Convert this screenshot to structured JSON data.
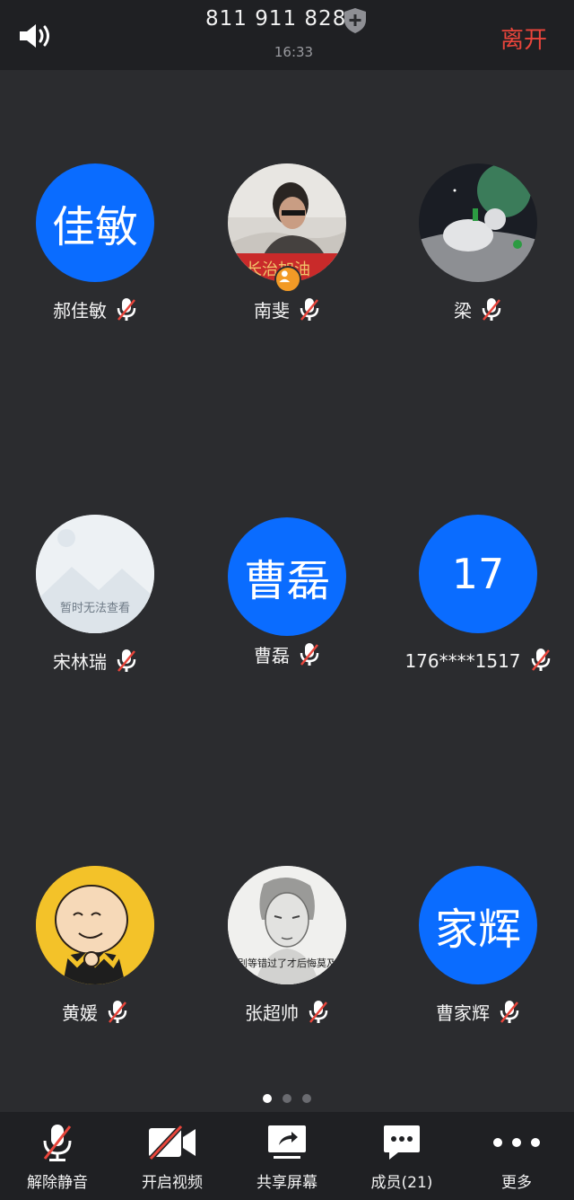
{
  "header": {
    "meeting_id": "811 911 828",
    "time": "16:33",
    "leave_label": "离开"
  },
  "participants": [
    {
      "name": "郝佳敏",
      "avatar_text": "佳敏",
      "avatar_type": "text",
      "muted": true
    },
    {
      "name": "南斐",
      "avatar_type": "photo",
      "host": true,
      "muted": true,
      "photo_caption": "长治加油"
    },
    {
      "name": "梁",
      "avatar_type": "photo",
      "muted": true
    },
    {
      "name": "宋林瑞",
      "avatar_type": "placeholder",
      "placeholder_text": "暂时无法查看",
      "muted": true
    },
    {
      "name": "曹磊",
      "avatar_text": "曹磊",
      "avatar_type": "text",
      "muted": true
    },
    {
      "name": "176****1517",
      "avatar_text": "17",
      "avatar_type": "text",
      "muted": true
    },
    {
      "name": "黄媛",
      "avatar_type": "photo",
      "muted": true
    },
    {
      "name": "张超帅",
      "avatar_type": "photo",
      "muted": true,
      "photo_caption": "别等错过了才后悔莫及"
    },
    {
      "name": "曹家辉",
      "avatar_text": "家辉",
      "avatar_type": "text",
      "muted": true
    }
  ],
  "pager": {
    "pages": 3,
    "current": 1
  },
  "toolbar": {
    "unmute_label": "解除静音",
    "video_label": "开启视频",
    "share_label": "共享屏幕",
    "members_label": "成员(21)",
    "more_label": "更多"
  },
  "colors": {
    "accent": "#0a6cff",
    "leave": "#e9453b",
    "background": "#2b2c2f",
    "bar": "#1f2023",
    "mute_slash": "#e9453b"
  }
}
